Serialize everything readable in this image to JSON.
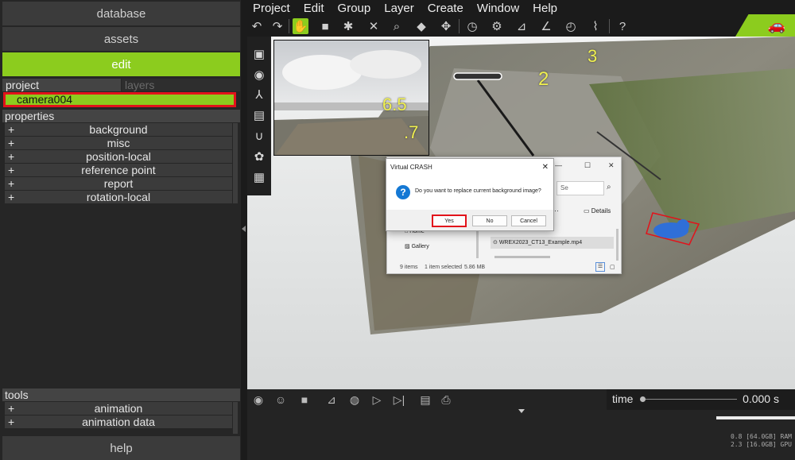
{
  "nav": {
    "database": "database",
    "assets": "assets",
    "edit": "edit",
    "help": "help"
  },
  "tabs": {
    "project": "project",
    "layers": "layers"
  },
  "project_items": [
    "camera004"
  ],
  "properties": {
    "header": "properties",
    "items": [
      "background",
      "misc",
      "position-local",
      "reference point",
      "report",
      "rotation-local"
    ]
  },
  "tools": {
    "header": "tools",
    "items": [
      "animation",
      "animation data"
    ]
  },
  "menu": [
    "Project",
    "Edit",
    "Group",
    "Layer",
    "Create",
    "Window",
    "Help"
  ],
  "toolbar_icons": [
    "undo-icon",
    "redo-icon",
    "hand-icon",
    "select-box-icon",
    "pin-icon",
    "delete-icon",
    "zoom-icon",
    "cube-icon",
    "move-icon",
    "gauge-icon",
    "link-icon",
    "measure-icon",
    "timer-icon",
    "tape-icon",
    "help-icon"
  ],
  "viewport_labels": {
    "label_3": "3",
    "label_2": "2",
    "label_65": "6.5",
    "label_7": ".7"
  },
  "dialog": {
    "title": "Virtual CRASH",
    "message": "Do you want to replace current background image?",
    "yes": "Yes",
    "no": "No",
    "cancel": "Cancel"
  },
  "explorer": {
    "search": "Se",
    "details": "Details",
    "nav_home": "Home",
    "nav_gallery": "Gallery",
    "file": "WREX2023_CT13_Example.mp4",
    "status_items": "9 items",
    "status_selected": "1 item selected",
    "status_size": "5.86 MB"
  },
  "time": {
    "label": "time",
    "value": "0.000 s"
  },
  "stats": {
    "ram": "0.8 [64.0GB] RAM",
    "gpu": "2.3 [16.0GB] GPU"
  },
  "colors": {
    "accent": "#8ccc1e",
    "highlight": "#e2131b",
    "label_yellow": "#f0f050"
  }
}
